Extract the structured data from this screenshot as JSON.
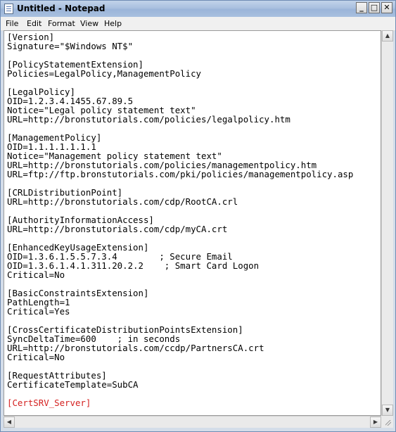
{
  "window": {
    "title": "Untitled - Notepad",
    "controls": {
      "minimize": "_",
      "maximize": "□",
      "close": "✕"
    }
  },
  "menu": {
    "items": [
      "File",
      "Edit",
      "Format",
      "View",
      "Help"
    ]
  },
  "document": {
    "lines": [
      "[Version]",
      "Signature=\"$Windows NT$\"",
      "",
      "[PolicyStatementExtension]",
      "Policies=LegalPolicy,ManagementPolicy",
      "",
      "[LegalPolicy]",
      "OID=1.2.3.4.1455.67.89.5",
      "Notice=\"Legal policy statement text\"",
      "URL=http://bronstutorials.com/policies/legalpolicy.htm",
      "",
      "[ManagementPolicy]",
      "OID=1.1.1.1.1.1.1",
      "Notice=\"Management policy statement text\"",
      "URL=http://bronstutorials.com/policies/managementpolicy.htm",
      "URL=ftp://ftp.bronstutorials.com/pki/policies/managementpolicy.asp",
      "",
      "[CRLDistributionPoint]",
      "URL=http://bronstutorials.com/cdp/RootCA.crl",
      "",
      "[AuthorityInformationAccess]",
      "URL=http://bronstutorials.com/cdp/myCA.crt",
      "",
      "[EnhancedKeyUsageExtension]",
      "OID=1.3.6.1.5.5.7.3.4        ; Secure Email",
      "OID=1.3.6.1.4.1.311.20.2.2    ; Smart Card Logon",
      "Critical=No",
      "",
      "[BasicConstraintsExtension]",
      "PathLength=1",
      "Critical=Yes",
      "",
      "[CrossCertificateDistributionPointsExtension]",
      "SyncDeltaTime=600    ; in seconds",
      "URL=http://bronstutorials.com/ccdp/PartnersCA.crt",
      "Critical=No",
      "",
      "[RequestAttributes]",
      "CertificateTemplate=SubCA",
      "",
      "[CertSRV_Server]"
    ],
    "highlighted_line": 40,
    "highlight_color": "#d4201f"
  },
  "scrollbar_glyphs": {
    "up": "▲",
    "down": "▼",
    "left": "◀",
    "right": "▶"
  }
}
